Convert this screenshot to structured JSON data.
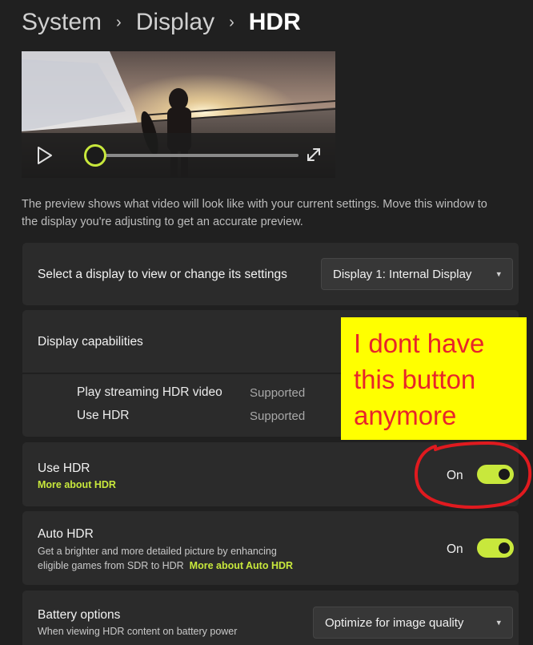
{
  "breadcrumb": {
    "items": [
      "System",
      "Display",
      "HDR"
    ],
    "separator": "›"
  },
  "preview": {
    "description": "The preview shows what video will look like with your current settings. Move this window to the display you're adjusting to get an accurate preview.",
    "progress": 0.03
  },
  "display_select": {
    "label": "Select a display to view or change its settings",
    "value": "Display 1: Internal Display"
  },
  "capabilities": {
    "title": "Display capabilities",
    "rows": [
      {
        "name": "Play streaming HDR video",
        "value": "Supported"
      },
      {
        "name": "Use HDR",
        "value": "Supported"
      }
    ]
  },
  "use_hdr": {
    "title": "Use HDR",
    "link": "More about HDR",
    "state": "On"
  },
  "auto_hdr": {
    "title": "Auto HDR",
    "desc_line1": "Get a brighter and more detailed picture by enhancing",
    "desc_line2": "eligible games from SDR to HDR",
    "link": "More about Auto HDR",
    "state": "On"
  },
  "battery": {
    "title": "Battery options",
    "desc": "When viewing HDR content on battery power",
    "value": "Optimize for image quality"
  },
  "annotation": {
    "line1": "I dont have",
    "line2": "this button",
    "line3": "anymore"
  },
  "colors": {
    "accent": "#c8e83c",
    "background": "#202020",
    "card": "#2b2b2b",
    "annotation_bg": "#ffff00",
    "annotation_text": "#e8252a"
  }
}
